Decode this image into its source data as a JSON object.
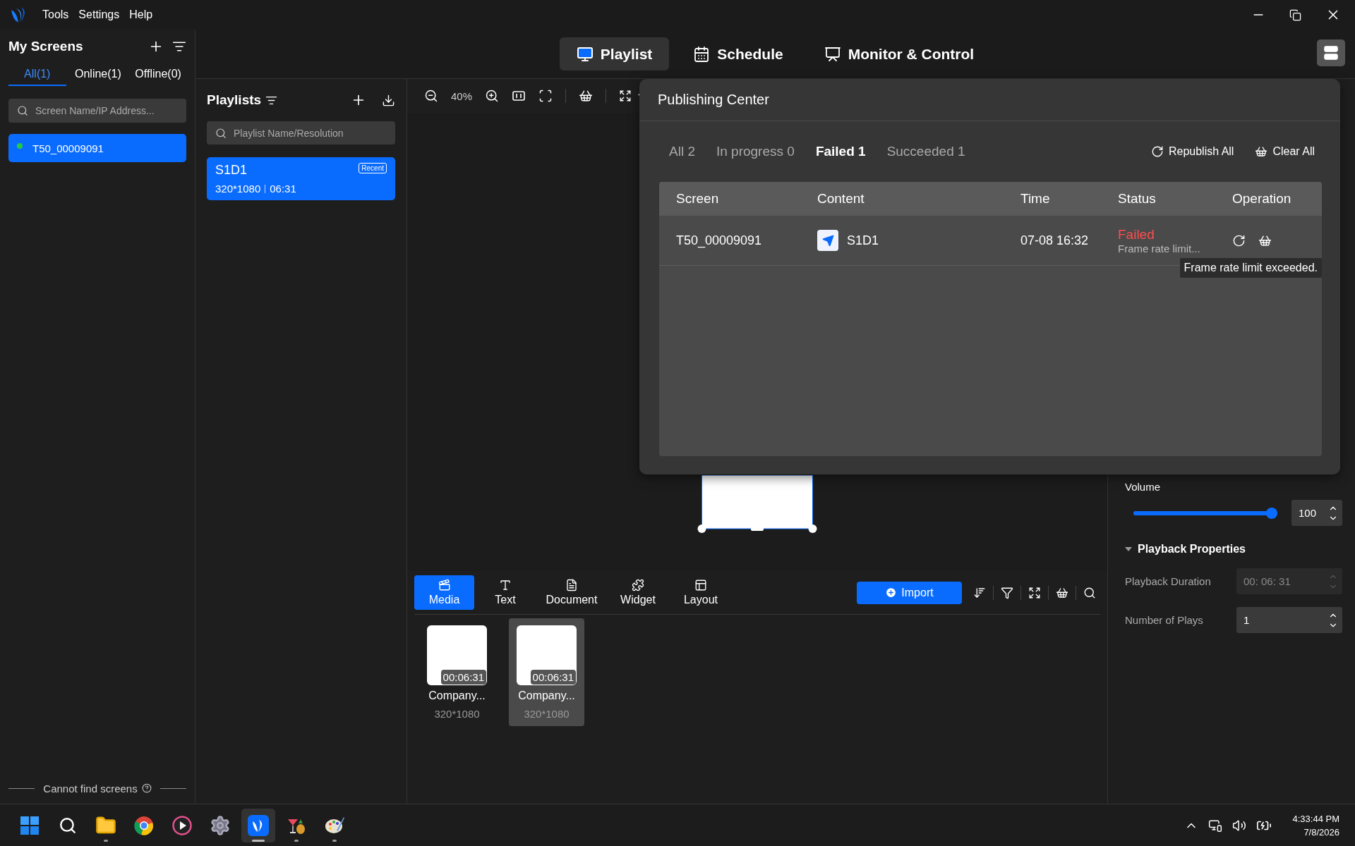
{
  "menu": [
    "Tools",
    "Settings",
    "Help"
  ],
  "sidebar": {
    "title": "My Screens",
    "tabs": [
      {
        "label": "All(1)",
        "selected": true
      },
      {
        "label": "Online(1)",
        "selected": false
      },
      {
        "label": "Offline(0)",
        "selected": false
      }
    ],
    "search": {
      "placeholder": "Screen Name/IP Address..."
    },
    "screens": [
      {
        "name": "T50_00009091",
        "online": true,
        "selected": true
      }
    ],
    "footer": "Cannot find screens"
  },
  "nav": [
    {
      "label": "Playlist",
      "kind": "playlist",
      "selected": true
    },
    {
      "label": "Schedule",
      "kind": "schedule",
      "selected": false
    },
    {
      "label": "Monitor & Control",
      "kind": "monitor",
      "selected": false
    }
  ],
  "playlists": {
    "title": "Playlists",
    "search": {
      "placeholder": "Playlist Name/Resolution"
    },
    "items": [
      {
        "name": "S1D1",
        "badge": "Recent",
        "resolution": "320*1080",
        "duration": "06:31",
        "selected": true
      }
    ]
  },
  "editor": {
    "zoom": "40%"
  },
  "media": {
    "tabs": [
      {
        "label": "Media",
        "kind": "media",
        "selected": true
      },
      {
        "label": "Text",
        "kind": "text",
        "selected": false
      },
      {
        "label": "Document",
        "kind": "document",
        "selected": false
      },
      {
        "label": "Widget",
        "kind": "widget",
        "selected": false
      },
      {
        "label": "Layout",
        "kind": "layout",
        "selected": false
      }
    ],
    "import": "Import",
    "items": [
      {
        "duration": "00:06:31",
        "name": "Company...",
        "resolution": "320*1080",
        "selected": false
      },
      {
        "duration": "00:06:31",
        "name": "Company...",
        "resolution": "320*1080",
        "selected": true
      }
    ]
  },
  "properties": {
    "volume": {
      "label": "Volume",
      "level": 1,
      "value": "100"
    },
    "section": {
      "title": "Playback Properties",
      "expanded": true
    },
    "fields": [
      {
        "label": "Playback Duration",
        "value": "00: 06: 31",
        "disabled": true
      },
      {
        "label": "Number of Plays",
        "value": "1",
        "disabled": false
      }
    ]
  },
  "publishing_center": {
    "title": "Publishing Center",
    "filters": [
      {
        "label": "All 2",
        "selected": false
      },
      {
        "label": "In progress 0",
        "selected": false
      },
      {
        "label": "Failed 1",
        "selected": true
      },
      {
        "label": "Succeeded 1",
        "selected": false
      }
    ],
    "actions": [
      {
        "label": "Republish All",
        "kind": "republish"
      },
      {
        "label": "Clear All",
        "kind": "clear"
      }
    ],
    "columns": [
      "Screen",
      "Content",
      "Time",
      "Status",
      "Operation"
    ],
    "rows": [
      {
        "screen": "T50_00009091",
        "content": "S1D1",
        "time": "07-08 16:32",
        "status": "Failed",
        "failed": true,
        "detail": "Frame rate limit..."
      }
    ],
    "tooltip": "Frame rate limit exceeded."
  },
  "taskbar": [
    {
      "kind": "start",
      "running": false,
      "active": false
    },
    {
      "kind": "search",
      "running": false,
      "active": false
    },
    {
      "kind": "files",
      "running": true,
      "active": false
    },
    {
      "kind": "browser",
      "running": false,
      "active": false
    },
    {
      "kind": "player",
      "running": false,
      "active": false
    },
    {
      "kind": "settings",
      "running": false,
      "active": false
    },
    {
      "kind": "app",
      "running": true,
      "active": true
    },
    {
      "kind": "cocktail",
      "running": true,
      "active": false
    },
    {
      "kind": "paint",
      "running": true,
      "active": false
    }
  ],
  "clock": {
    "time": "4:33:44 PM",
    "date": "7/8/2026"
  }
}
